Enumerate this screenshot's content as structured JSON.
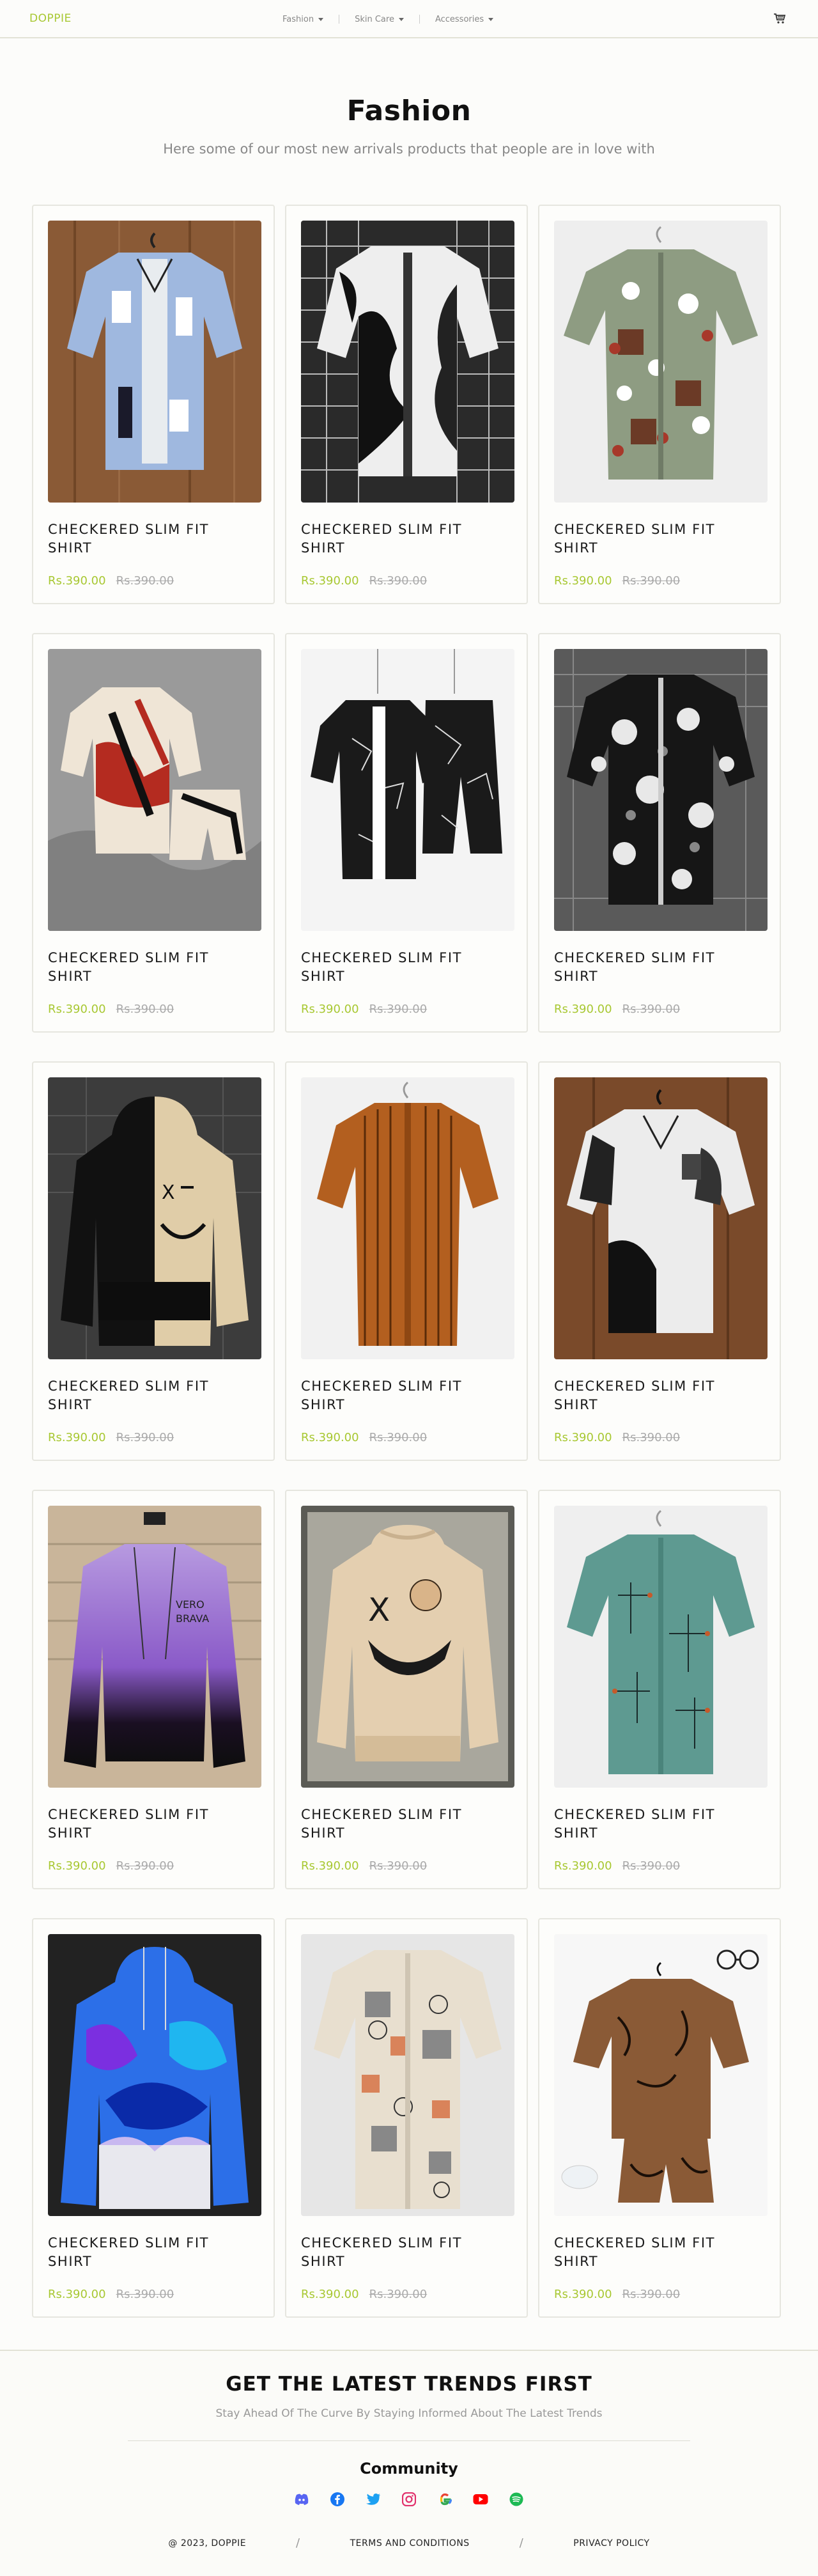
{
  "nav": {
    "brand": "DOPPIE",
    "menu": [
      {
        "label": "Fashion"
      },
      {
        "label": "Skin Care"
      },
      {
        "label": "Accessories"
      }
    ],
    "cart_icon": "cart-icon"
  },
  "hero": {
    "title": "Fashion",
    "subtitle": "Here some of our most new arrivals products that people are in love with"
  },
  "products": [
    {
      "title": "CHECKERED SLIM FIT SHIRT",
      "price": "Rs.390.00",
      "old_price": "Rs.390.00"
    },
    {
      "title": "CHECKERED SLIM FIT SHIRT",
      "price": "Rs.390.00",
      "old_price": "Rs.390.00"
    },
    {
      "title": "CHECKERED SLIM FIT SHIRT",
      "price": "Rs.390.00",
      "old_price": "Rs.390.00"
    },
    {
      "title": "CHECKERED SLIM FIT SHIRT",
      "price": "Rs.390.00",
      "old_price": "Rs.390.00"
    },
    {
      "title": "CHECKERED SLIM FIT SHIRT",
      "price": "Rs.390.00",
      "old_price": "Rs.390.00"
    },
    {
      "title": "CHECKERED SLIM FIT SHIRT",
      "price": "Rs.390.00",
      "old_price": "Rs.390.00"
    },
    {
      "title": "CHECKERED SLIM FIT SHIRT",
      "price": "Rs.390.00",
      "old_price": "Rs.390.00"
    },
    {
      "title": "CHECKERED SLIM FIT SHIRT",
      "price": "Rs.390.00",
      "old_price": "Rs.390.00"
    },
    {
      "title": "CHECKERED SLIM FIT SHIRT",
      "price": "Rs.390.00",
      "old_price": "Rs.390.00"
    },
    {
      "title": "CHECKERED SLIM FIT SHIRT",
      "price": "Rs.390.00",
      "old_price": "Rs.390.00"
    },
    {
      "title": "CHECKERED SLIM FIT SHIRT",
      "price": "Rs.390.00",
      "old_price": "Rs.390.00"
    },
    {
      "title": "CHECKERED SLIM FIT SHIRT",
      "price": "Rs.390.00",
      "old_price": "Rs.390.00"
    },
    {
      "title": "CHECKERED SLIM FIT SHIRT",
      "price": "Rs.390.00",
      "old_price": "Rs.390.00"
    },
    {
      "title": "CHECKERED SLIM FIT SHIRT",
      "price": "Rs.390.00",
      "old_price": "Rs.390.00"
    },
    {
      "title": "CHECKERED SLIM FIT SHIRT",
      "price": "Rs.390.00",
      "old_price": "Rs.390.00"
    }
  ],
  "footer": {
    "title": "GET THE LATEST TRENDS FIRST",
    "subtitle": "Stay Ahead Of The Curve By Staying Informed About The Latest Trends",
    "community": "Community",
    "socials": [
      "discord-icon",
      "facebook-icon",
      "twitter-icon",
      "instagram-icon",
      "google-icon",
      "youtube-icon",
      "spotify-icon"
    ],
    "copyright": "@ 2023, DOPPIE",
    "terms": "TERMS AND CONDITIONS",
    "privacy": "PRIVACY POLICY"
  },
  "colors": {
    "accent": "#a8c832"
  }
}
